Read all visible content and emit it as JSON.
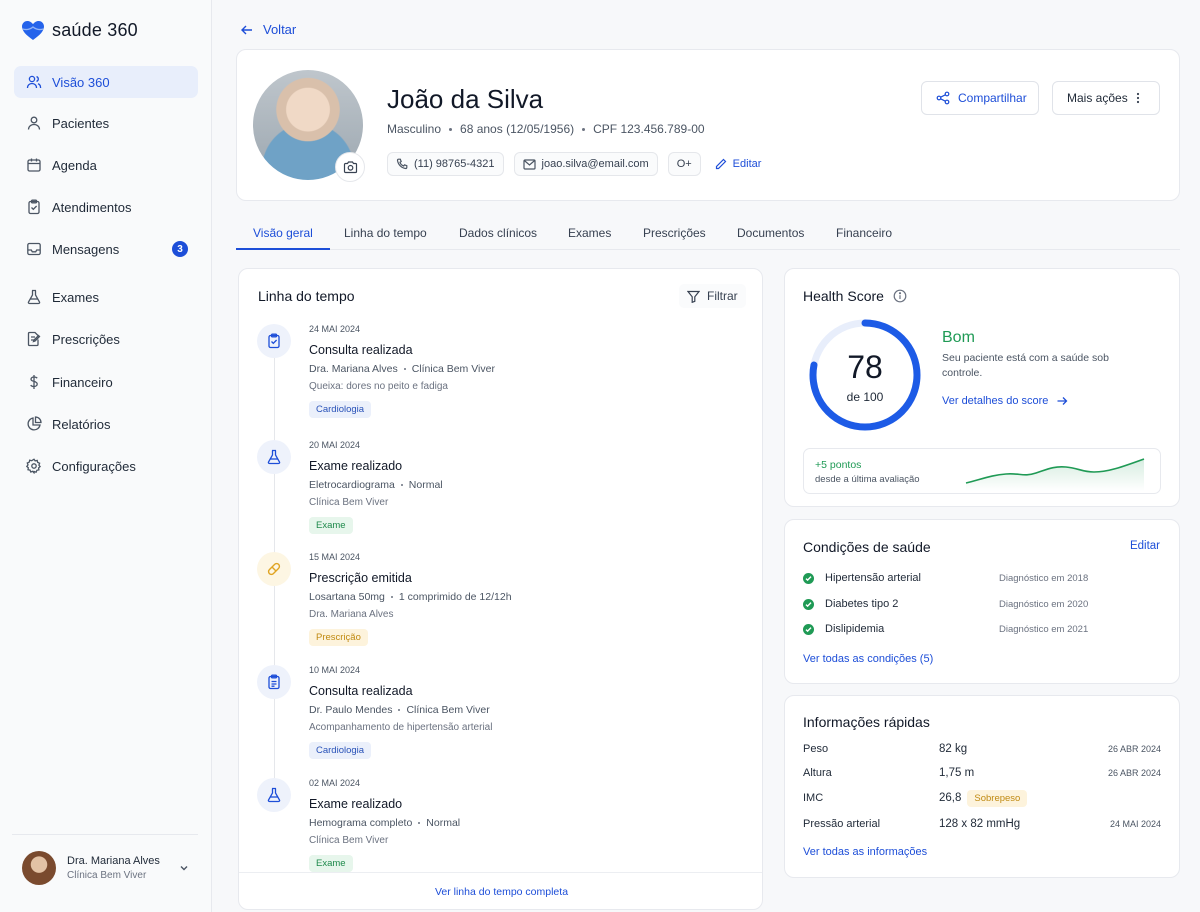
{
  "brand": {
    "name": "saúde 360"
  },
  "nav": {
    "items": [
      {
        "label": "Visão 360",
        "icon": "users-icon"
      },
      {
        "label": "Pacientes",
        "icon": "user-icon"
      },
      {
        "label": "Agenda",
        "icon": "calendar-icon"
      },
      {
        "label": "Atendimentos",
        "icon": "clipboard-icon"
      },
      {
        "label": "Mensagens",
        "icon": "inbox-icon",
        "badge": "3"
      },
      {
        "label": "Exames",
        "icon": "flask-icon"
      },
      {
        "label": "Prescrições",
        "icon": "prescription-icon"
      },
      {
        "label": "Financeiro",
        "icon": "dollar-icon"
      },
      {
        "label": "Relatórios",
        "icon": "pie-chart-icon"
      },
      {
        "label": "Configurações",
        "icon": "gear-icon"
      }
    ]
  },
  "user": {
    "name": "Dra. Mariana Alves",
    "clinic": "Clínica Bem Viver"
  },
  "back_label": "Voltar",
  "patient": {
    "name": "João da Silva",
    "sex": "Masculino",
    "age": "68 anos (12/05/1956)",
    "cpf": "CPF 123.456.789-00",
    "phone": "(11) 98765-4321",
    "email": "joao.silva@email.com",
    "blood": "O+",
    "edit_label": "Editar"
  },
  "actions": {
    "share": "Compartilhar",
    "more": "Mais ações"
  },
  "tabs": [
    "Visão geral",
    "Linha do tempo",
    "Dados clínicos",
    "Exames",
    "Prescrições",
    "Documentos",
    "Financeiro"
  ],
  "timeline": {
    "title": "Linha do tempo",
    "filter_label": "Filtrar",
    "footer_link": "Ver linha do tempo completa",
    "items": [
      {
        "date": "24 MAI 2024",
        "title": "Consulta realizada",
        "sub_a": "Dra. Mariana Alves",
        "sub_b": "Clínica Bem Viver",
        "note": "Queixa: dores no peito e fadiga",
        "tag": "Cardiologia",
        "tag_color": "blue",
        "icon": "clipboard-icon"
      },
      {
        "date": "20 MAI 2024",
        "title": "Exame realizado",
        "sub_a": "Eletrocardiograma",
        "sub_b": "Normal",
        "note": "Clínica Bem Viver",
        "tag": "Exame",
        "tag_color": "green",
        "icon": "flask-icon"
      },
      {
        "date": "15 MAI 2024",
        "title": "Prescrição emitida",
        "sub_a": "Losartana 50mg",
        "sub_b": "1 comprimido de 12/12h",
        "note": "Dra. Mariana Alves",
        "tag": "Prescrição",
        "tag_color": "yellow",
        "icon": "pill-icon"
      },
      {
        "date": "10 MAI 2024",
        "title": "Consulta realizada",
        "sub_a": "Dr. Paulo Mendes",
        "sub_b": "Clínica Bem Viver",
        "note": "Acompanhamento de hipertensão arterial",
        "tag": "Cardiologia",
        "tag_color": "blue",
        "icon": "document-icon"
      },
      {
        "date": "02 MAI 2024",
        "title": "Exame realizado",
        "sub_a": "Hemograma completo",
        "sub_b": "Normal",
        "note": "Clínica Bem Viver",
        "tag": "Exame",
        "tag_color": "green",
        "icon": "flask-icon"
      }
    ]
  },
  "health_score": {
    "title": "Health Score",
    "value": "78",
    "of_label": "de 100",
    "score_fraction": 0.78,
    "status": "Bom",
    "description": "Seu paciente está com a saúde sob controle.",
    "details_link": "Ver detalhes do score",
    "trend_value": "+5 pontos",
    "trend_sub": "desde a última avaliação",
    "accent": "#1d5be6",
    "good_color": "#1f9a55"
  },
  "conditions": {
    "title": "Condições de saúde",
    "edit_label": "Editar",
    "items": [
      {
        "name": "Hipertensão arterial",
        "date": "Diagnóstico em 2018"
      },
      {
        "name": "Diabetes tipo 2",
        "date": "Diagnóstico em 2020"
      },
      {
        "name": "Dislipidemia",
        "date": "Diagnóstico em 2021"
      }
    ],
    "see_all": "Ver todas as condições (5)"
  },
  "quick_info": {
    "title": "Informações rápidas",
    "rows": [
      {
        "label": "Peso",
        "value": "82 kg",
        "date": "26 ABR 2024",
        "badge": ""
      },
      {
        "label": "Altura",
        "value": "1,75 m",
        "date": "26 ABR 2024",
        "badge": ""
      },
      {
        "label": "IMC",
        "value": "26,8",
        "date": "",
        "badge": "Sobrepeso"
      },
      {
        "label": "Pressão arterial",
        "value": "128 x 82 mmHg",
        "date": "24 MAI 2024",
        "badge": ""
      }
    ],
    "see_all": "Ver todas as informações"
  }
}
